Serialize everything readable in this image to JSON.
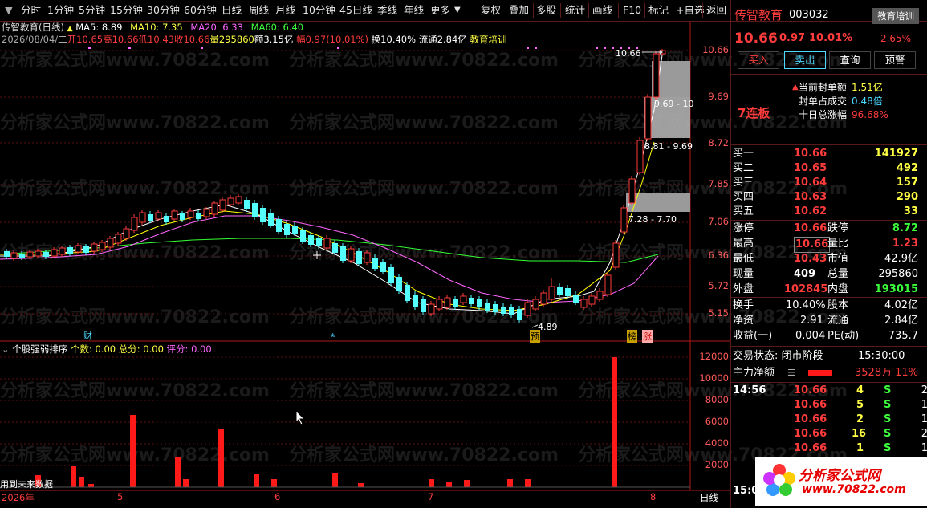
{
  "topbar": {
    "tabs": [
      "分时",
      "1分钟",
      "5分钟",
      "15分钟",
      "30分钟",
      "60分钟",
      "日线",
      "周线",
      "月线",
      "10分钟",
      "45日线",
      "季线",
      "年线",
      "更多"
    ],
    "active": "日线",
    "more_icon": "chevron-down-icon",
    "tools": [
      "复权",
      "叠加",
      "多股",
      "统计",
      "画线",
      "F10",
      "标记",
      "+自选",
      "返回"
    ]
  },
  "chart": {
    "title": "传智教育(日线)",
    "title_arrow": "▲",
    "ma5": "MA5: 8.89",
    "ma10": "MA10: 7.35",
    "ma20": "MA20: 6.33",
    "ma60": "MA60: 6.40",
    "date": "2026/08/04/二",
    "open": "开10.65",
    "high": "高10.66",
    "low": "低10.43",
    "close": "收10.66",
    "vol": "量295860",
    "amount": "额3.15亿",
    "pct": "幅0.97(10.01%)",
    "turnover": "换10.40%",
    "float": "流通2.84亿",
    "concept": "教育培训",
    "price_axis": [
      "10.66",
      "9.69",
      "8.72",
      "7.85",
      "7.06",
      "6.36",
      "5.72",
      "5.15"
    ],
    "labels": {
      "high_mark": "10.66",
      "box1": "9.69 - 10",
      "box2": "8.81 - 9.69",
      "box3": "7.28 - 7.70",
      "low_mark": "4.89",
      "cai": "财",
      "yu": "预",
      "bang": "榜",
      "zhang": "涨"
    },
    "colors": {
      "up": "#ff3c3c",
      "down": "#54ffff",
      "ma5": "#ffffff",
      "ma10": "#ffff00",
      "ma20": "#ff66ff",
      "ma60": "#33ff33"
    }
  },
  "indicator": {
    "name": "个股强弱排序",
    "count": "个数: 0.00",
    "total": "总分: 0.00",
    "score": "评分: 0.00",
    "axis": [
      "12000",
      "10000",
      "8000",
      "6000",
      "4000",
      "2000"
    ],
    "future": "用到未来数据"
  },
  "xaxis": {
    "labels": [
      "2026年",
      "5",
      "6",
      "7",
      "8"
    ],
    "period": "日线"
  },
  "watermark": "分析家公式网www.70822.com",
  "quote": {
    "name": "传智教育",
    "code": "003032",
    "concept_btn": "教育培训",
    "price": "10.66",
    "change": "0.97",
    "pct": "10.01%",
    "concept_pct": "2.65%",
    "buttons": [
      "买入",
      "卖出",
      "查询",
      "预警"
    ],
    "limit_title": "7连板",
    "limit_rows": [
      {
        "label": "当前封单额",
        "value": "1.51亿"
      },
      {
        "label": "封单占成交",
        "value": "0.48倍"
      },
      {
        "label": "十日总涨幅",
        "value": "96.68%"
      }
    ],
    "bids": [
      {
        "label": "买一",
        "price": "10.66",
        "vol": "141927"
      },
      {
        "label": "买二",
        "price": "10.65",
        "vol": "492"
      },
      {
        "label": "买三",
        "price": "10.64",
        "vol": "157"
      },
      {
        "label": "买四",
        "price": "10.63",
        "vol": "290"
      },
      {
        "label": "买五",
        "price": "10.62",
        "vol": "33"
      }
    ],
    "stats": [
      {
        "l1": "涨停",
        "v1": "10.66",
        "l2": "跌停",
        "v2": "8.72"
      },
      {
        "l1": "最高",
        "v1": "10.66",
        "l2": "量比",
        "v2": "1.23"
      },
      {
        "l1": "最低",
        "v1": "10.43",
        "l2": "市值",
        "v2": "42.9亿"
      },
      {
        "l1": "现量",
        "v1": "409",
        "l2": "总量",
        "v2": "295860"
      },
      {
        "l1": "外盘",
        "v1": "102845",
        "l2": "内盘",
        "v2": "193015"
      },
      {
        "l1": "换手",
        "v1": "10.40%",
        "l2": "股本",
        "v2": "4.02亿"
      },
      {
        "l1": "净资",
        "v1": "2.91",
        "l2": "流通",
        "v2": "2.84亿"
      },
      {
        "l1": "收益(一)",
        "v1": "0.004",
        "l2": "PE(动)",
        "v2": "735.7"
      }
    ],
    "status": "交易状态: 闭市阶段",
    "status_time": "15:30:00",
    "main_flow_label": "主力净额",
    "main_flow_value": "3528万",
    "main_flow_pct": "11%",
    "ticks": [
      {
        "time": "14:56",
        "price": "10.66",
        "vol": "4",
        "side": "S",
        "n": "2"
      },
      {
        "time": "",
        "price": "10.66",
        "vol": "5",
        "side": "S",
        "n": "1"
      },
      {
        "time": "",
        "price": "10.66",
        "vol": "2",
        "side": "S",
        "n": "1"
      },
      {
        "time": "",
        "price": "10.66",
        "vol": "16",
        "side": "S",
        "n": "2"
      },
      {
        "time": "",
        "price": "10.66",
        "vol": "1",
        "side": "S",
        "n": "1"
      }
    ],
    "bottom_time": "15:00",
    "logo_text": "分析家公式网",
    "logo_url": "www.70822.com"
  }
}
